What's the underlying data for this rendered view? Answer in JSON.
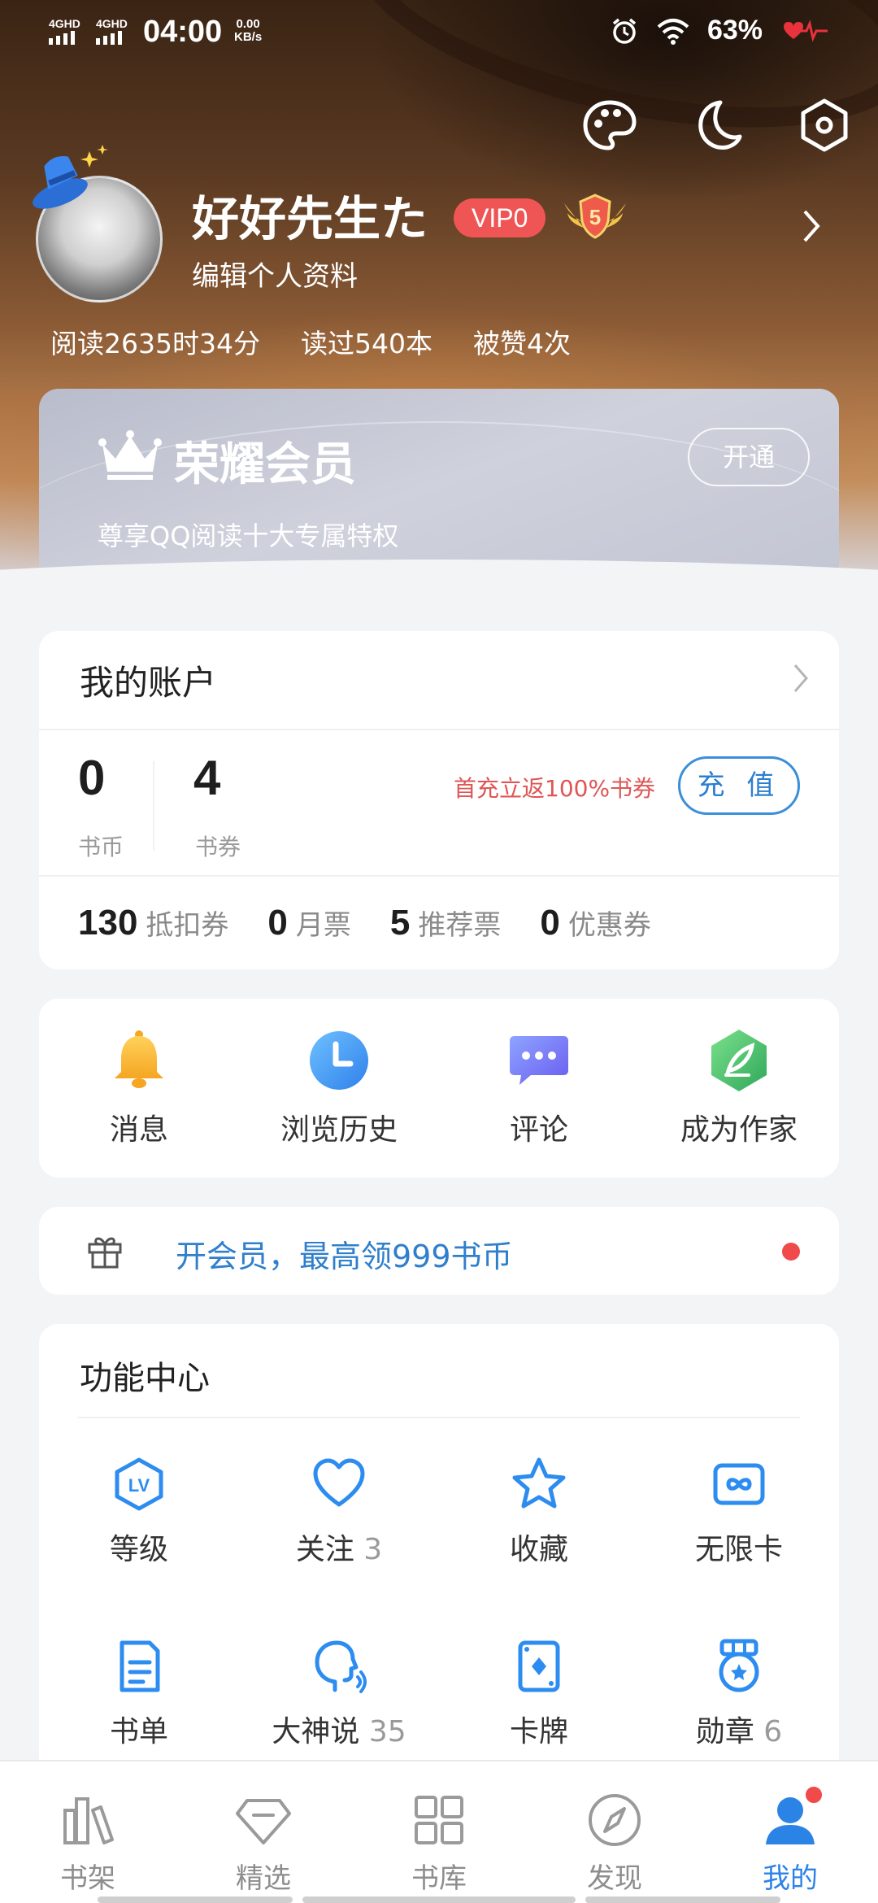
{
  "status_bar": {
    "net1": "4GHD",
    "net2": "4GHD",
    "time": "04:00",
    "speed_value": "0.00",
    "speed_unit": "KB/s",
    "battery": "63%"
  },
  "header": {
    "icons": [
      "palette-icon",
      "moon-icon",
      "settings-hexagon-icon"
    ],
    "username": "好好先生た",
    "vip_badge": "VIP0",
    "level_badge": "5",
    "edit_profile": "编辑个人资料",
    "stats": {
      "reading_time": "阅读2635时34分",
      "books_read": "读过540本",
      "likes": "被赞4次"
    }
  },
  "vip_card": {
    "title": "荣耀会员",
    "subtitle": "尊享QQ阅读十大专属特权",
    "open_button": "开通"
  },
  "account": {
    "title": "我的账户",
    "coins_value": "0",
    "coins_label": "书币",
    "vouchers_value": "4",
    "vouchers_label": "书券",
    "promo": "首充立返100%书券",
    "recharge_button": "充 值",
    "tickets": [
      {
        "value": "130",
        "label": "抵扣券"
      },
      {
        "value": "0",
        "label": "月票"
      },
      {
        "value": "5",
        "label": "推荐票"
      },
      {
        "value": "0",
        "label": "优惠券"
      }
    ]
  },
  "shortcuts": [
    {
      "label": "消息",
      "icon": "bell-icon",
      "color": "#f7b731"
    },
    {
      "label": "浏览历史",
      "icon": "clock-icon",
      "color": "#3f9af0"
    },
    {
      "label": "评论",
      "icon": "comment-icon",
      "color": "#6b7cf5"
    },
    {
      "label": "成为作家",
      "icon": "feather-icon",
      "color": "#3fbf6b"
    }
  ],
  "banner": {
    "text": "开会员，最高领999书币"
  },
  "features": {
    "title": "功能中心",
    "items": [
      {
        "label": "等级",
        "count": "",
        "icon": "level-icon"
      },
      {
        "label": "关注",
        "count": "3",
        "icon": "heart-icon"
      },
      {
        "label": "收藏",
        "count": "",
        "icon": "star-icon"
      },
      {
        "label": "无限卡",
        "count": "",
        "icon": "infinity-card-icon"
      },
      {
        "label": "书单",
        "count": "",
        "icon": "booklist-icon"
      },
      {
        "label": "大神说",
        "count": "35",
        "icon": "speaking-head-icon"
      },
      {
        "label": "卡牌",
        "count": "",
        "icon": "card-icon"
      },
      {
        "label": "勋章",
        "count": "6",
        "icon": "medal-icon"
      }
    ]
  },
  "nav": [
    {
      "label": "书架",
      "icon": "bookshelf-icon"
    },
    {
      "label": "精选",
      "icon": "diamond-icon"
    },
    {
      "label": "书库",
      "icon": "grid-icon"
    },
    {
      "label": "发现",
      "icon": "compass-icon"
    },
    {
      "label": "我的",
      "icon": "profile-icon"
    }
  ],
  "colors": {
    "accent": "#2c83e6",
    "promo_red": "#e05555",
    "vip_badge": "#f05555"
  }
}
